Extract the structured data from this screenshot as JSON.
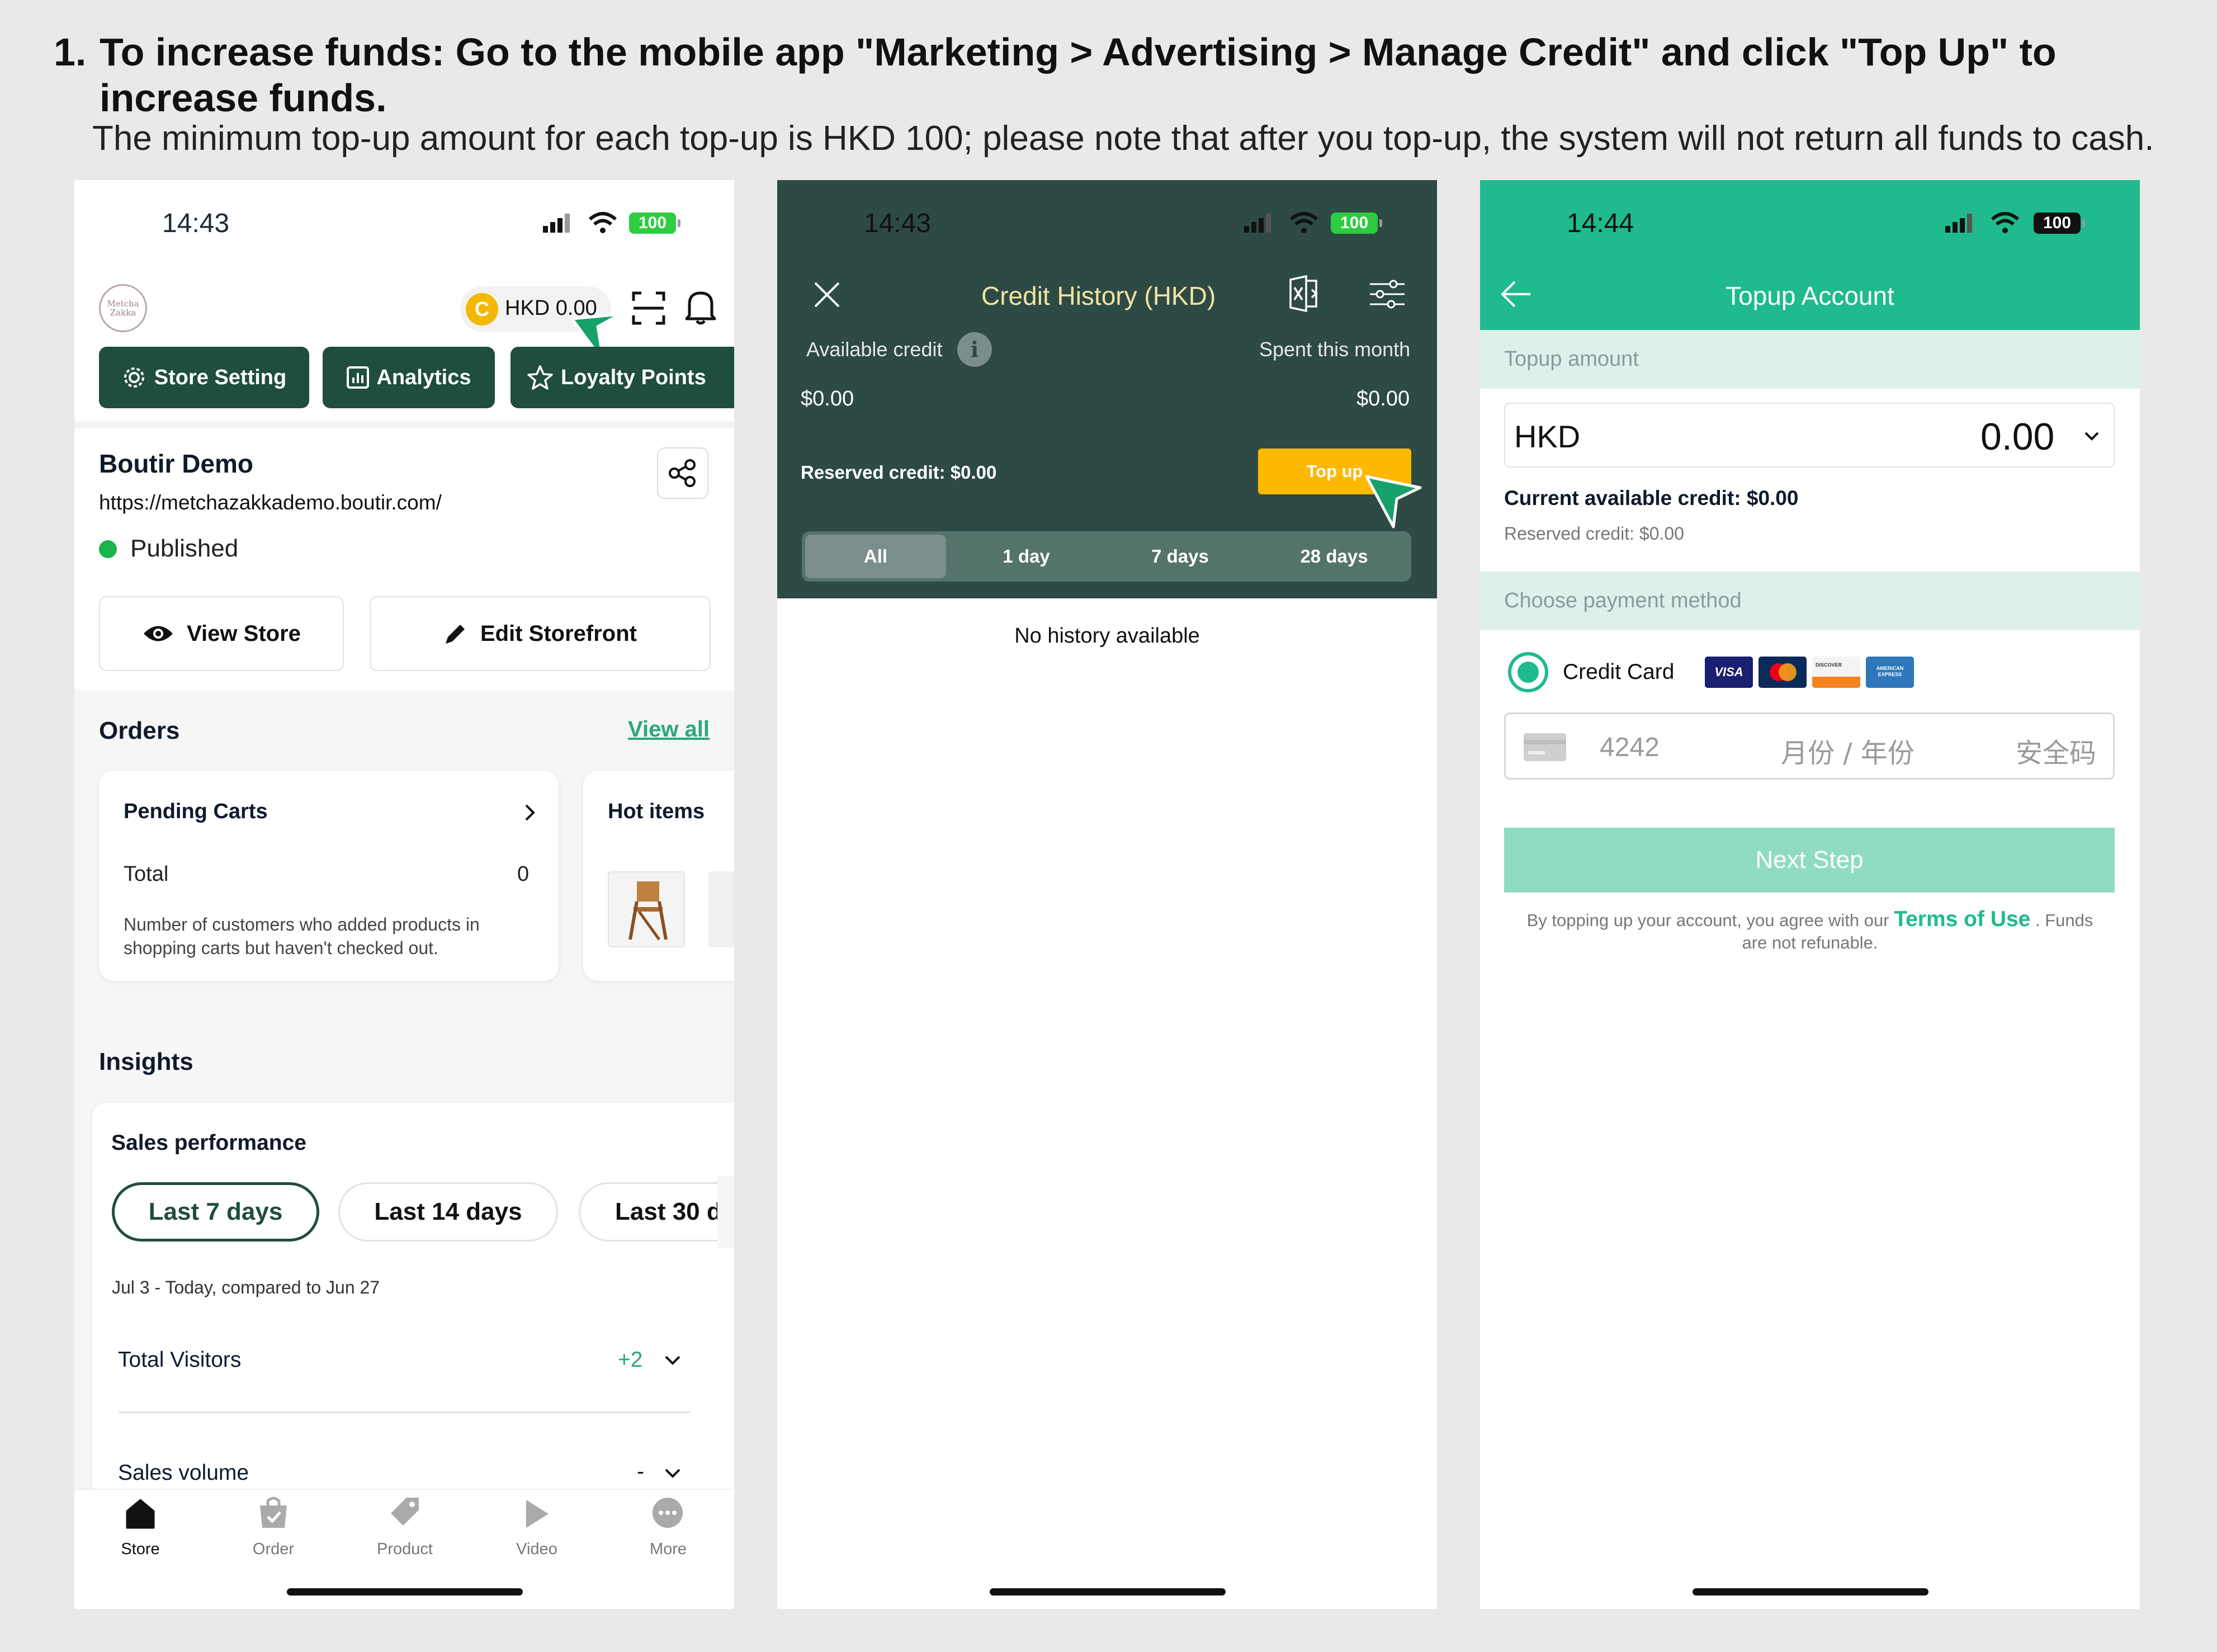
{
  "instruction": {
    "number": "1.",
    "title": "To increase funds: Go to the mobile app \"Marketing > Advertising > Manage Credit\" and click \"Top Up\" to increase funds.",
    "note": "The minimum top-up amount for each top-up is HKD 100; please note that after you top-up, the system will not return all funds to cash."
  },
  "phone1": {
    "time": "14:43",
    "battery": "100",
    "logo_text": "Metcha Zakka",
    "credit_coin": "C",
    "credit_label": "HKD 0.00",
    "quick_buttons": {
      "store_setting": "Store Setting",
      "analytics": "Analytics",
      "loyalty": "Loyalty Points"
    },
    "store": {
      "name": "Boutir Demo",
      "url": "https://metchazakkademo.boutir.com/",
      "status": "Published"
    },
    "buttons": {
      "view_store": "View Store",
      "edit_storefront": "Edit Storefront"
    },
    "orders": {
      "title": "Orders",
      "view_all": "View all",
      "pending_title": "Pending Carts",
      "total_label": "Total",
      "total_value": "0",
      "description": "Number of customers who added products in shopping carts but haven't checked out.",
      "hot_items": "Hot items"
    },
    "insights": {
      "title": "Insights",
      "sales_performance": "Sales performance",
      "ranges": [
        "Last 7 days",
        "Last 14 days",
        "Last 30 d"
      ],
      "date_range": "Jul 3 - Today, compared to Jun 27",
      "total_visitors": "Total Visitors",
      "visitors_delta": "+2",
      "sales_volume": "Sales volume",
      "sales_delta": "-"
    },
    "nav": [
      "Store",
      "Order",
      "Product",
      "Video",
      "More"
    ],
    "colors": {
      "primary": "#1f4d3f",
      "accent": "#2aa87c",
      "published": "#19b34b",
      "coin": "#f5b800"
    }
  },
  "phone2": {
    "time": "14:43",
    "battery": "100",
    "title": "Credit History (HKD)",
    "available_label": "Available credit",
    "available_value": "$0.00",
    "spent_label": "Spent this month",
    "spent_value": "$0.00",
    "reserved": "Reserved credit: $0.00",
    "topup_button": "Top up",
    "tabs": [
      "All",
      "1 day",
      "7 days",
      "28 days"
    ],
    "empty": "No history available",
    "colors": {
      "header": "#2d4a45",
      "button": "#ffb800"
    }
  },
  "phone3": {
    "time": "14:44",
    "battery": "100",
    "title": "Topup Account",
    "topup_amount_label": "Topup amount",
    "currency": "HKD",
    "amount": "0.00",
    "current_credit": "Current available credit: $0.00",
    "reserved": "Reserved credit: $0.00",
    "payment_label": "Choose payment method",
    "credit_card": "Credit Card",
    "card_brands": {
      "visa": "VISA",
      "discover": "DISCOVER",
      "amex": "AMERICAN EXPRESS"
    },
    "card_placeholder": "4242",
    "expiry_placeholder": "月份 / 年份",
    "cvc_placeholder": "安全码",
    "next_button": "Next Step",
    "terms_prefix": "By topping up your account, you agree with our",
    "terms_link": "Terms of Use",
    "terms_suffix": ". Funds",
    "terms_line2": "are not refunable.",
    "colors": {
      "header": "#1fba8e",
      "section": "#dff0ea",
      "button": "#8fdcc3"
    }
  }
}
